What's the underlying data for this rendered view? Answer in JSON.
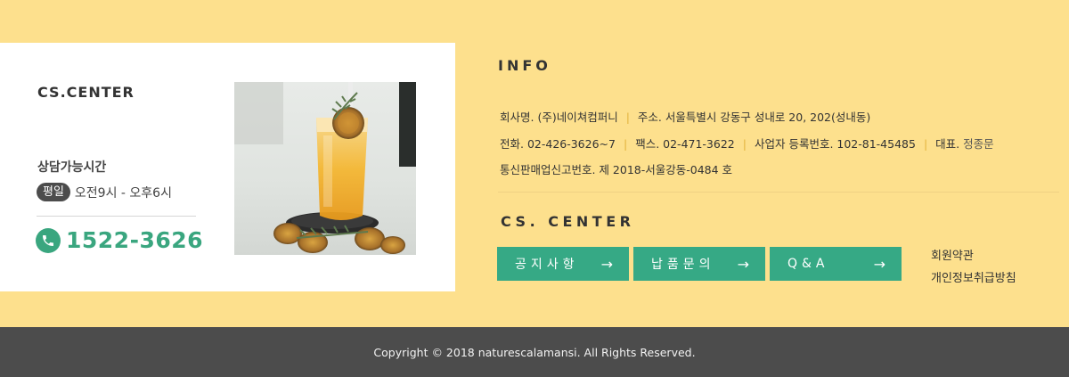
{
  "cs_card": {
    "title": "CS.CENTER",
    "hours_title": "상담가능시간",
    "weekday_badge": "평일",
    "hours": "오전9시 - 오후6시",
    "phone": "1522-3626"
  },
  "info": {
    "title": "INFO",
    "company_label": "회사명. (주)네이쳐컴퍼니",
    "address": "주소. 서울특별시 강동구 성내로 20, 202(성내동)",
    "tel": "전화. 02-426-3626~7",
    "fax": "팩스. 02-471-3622",
    "business_no": "사업자 등록번호. 102-81-45485",
    "ceo_label": "대표.",
    "ceo_name": "정종문",
    "mail_order_no": "통신판매업신고번호. 제 2018-서울강동-0484 호"
  },
  "cs_center": {
    "title": "CS. CENTER",
    "buttons": [
      {
        "label": "공지사항",
        "arrow": "→"
      },
      {
        "label": "납품문의",
        "arrow": "→"
      },
      {
        "label": "Q&A",
        "arrow": "→"
      }
    ],
    "links": [
      "회원약관",
      "개인정보취급방침"
    ]
  },
  "footer": {
    "copyright": "Copyright © 2018 naturescalamansi. All Rights Reserved."
  },
  "colors": {
    "background": "#fde08d",
    "accent_green": "#36a985",
    "copyright_bar": "#4c4c4c"
  }
}
